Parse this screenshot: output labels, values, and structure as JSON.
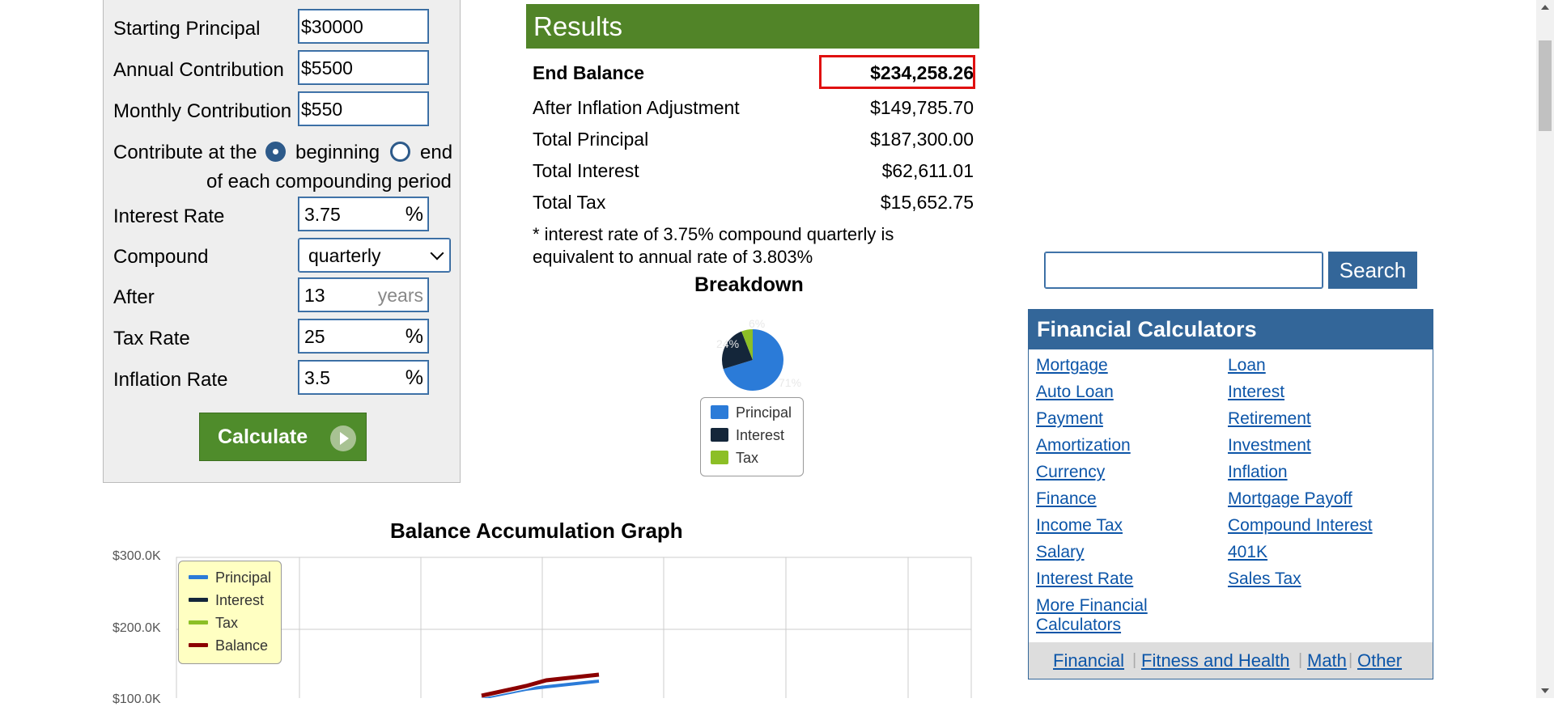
{
  "form": {
    "starting_principal": {
      "label": "Starting Principal",
      "value": "$30000"
    },
    "annual_contribution": {
      "label": "Annual Contribution",
      "value": "$5500"
    },
    "monthly_contribution": {
      "label": "Monthly Contribution",
      "value": "$550"
    },
    "contribute": {
      "label": "Contribute at the",
      "option_beginning": "beginning",
      "option_end": "end",
      "selected": "beginning",
      "suffix": "of each compounding period"
    },
    "interest_rate": {
      "label": "Interest Rate",
      "value": "3.75",
      "unit": "%"
    },
    "compound": {
      "label": "Compound",
      "value": "quarterly"
    },
    "after": {
      "label": "After",
      "value": "13",
      "unit": "years"
    },
    "tax_rate": {
      "label": "Tax Rate",
      "value": "25",
      "unit": "%"
    },
    "inflation_rate": {
      "label": "Inflation Rate",
      "value": "3.5",
      "unit": "%"
    },
    "calculate_label": "Calculate"
  },
  "results": {
    "title": "Results",
    "end_balance": {
      "label": "End Balance",
      "value": "$234,258.26"
    },
    "after_inflation": {
      "label": "After Inflation Adjustment",
      "value": "$149,785.70"
    },
    "total_principal": {
      "label": "Total Principal",
      "value": "$187,300.00"
    },
    "total_interest": {
      "label": "Total Interest",
      "value": "$62,611.01"
    },
    "total_tax": {
      "label": "Total Tax",
      "value": "$15,652.75"
    },
    "note_line1": "* interest rate of 3.75% compound quarterly is",
    "note_line2": "equivalent to annual rate of 3.803%"
  },
  "breakdown": {
    "title": "Breakdown",
    "slice_labels": [
      "6%",
      "24%",
      "71%"
    ],
    "legend": [
      "Principal",
      "Interest",
      "Tax"
    ]
  },
  "graph": {
    "title": "Balance Accumulation Graph",
    "y_ticks": [
      "$300.0K",
      "$200.0K",
      "$100.0K"
    ],
    "legend": [
      "Principal",
      "Interest",
      "Tax",
      "Balance"
    ]
  },
  "chart_data": [
    {
      "type": "pie",
      "title": "Breakdown",
      "categories": [
        "Principal",
        "Interest",
        "Tax"
      ],
      "values": [
        71,
        24,
        6
      ],
      "colors": [
        "#2b7bd8",
        "#14263a",
        "#8cbf26"
      ]
    },
    {
      "type": "line",
      "title": "Balance Accumulation Graph",
      "ylim": [
        0,
        300000
      ],
      "y_ticks": [
        "$300.0K",
        "$200.0K",
        "$100.0K"
      ],
      "series": [
        {
          "name": "Principal",
          "color": "#2b7bd8"
        },
        {
          "name": "Interest",
          "color": "#14263a"
        },
        {
          "name": "Tax",
          "color": "#8cbf26"
        },
        {
          "name": "Balance",
          "color": "#8b0000"
        }
      ]
    }
  ],
  "search": {
    "button_label": "Search",
    "placeholder": ""
  },
  "financial_calculators": {
    "title": "Financial Calculators",
    "col1": [
      "Mortgage",
      "Auto Loan",
      "Payment",
      "Amortization",
      "Currency",
      "Finance",
      "Income Tax",
      "Salary",
      "Interest Rate",
      "More Financial",
      "Calculators"
    ],
    "col2": [
      "Loan",
      "Interest",
      "Retirement",
      "Investment",
      "Inflation",
      "Mortgage Payoff",
      "Compound Interest",
      "401K",
      "Sales Tax"
    ],
    "footer": [
      "Financial",
      "Fitness and Health",
      "Math",
      "Other"
    ]
  },
  "colors": {
    "green": "#518428",
    "blue": "#336699",
    "link": "#0c55a8",
    "highlight": "#e01010"
  }
}
